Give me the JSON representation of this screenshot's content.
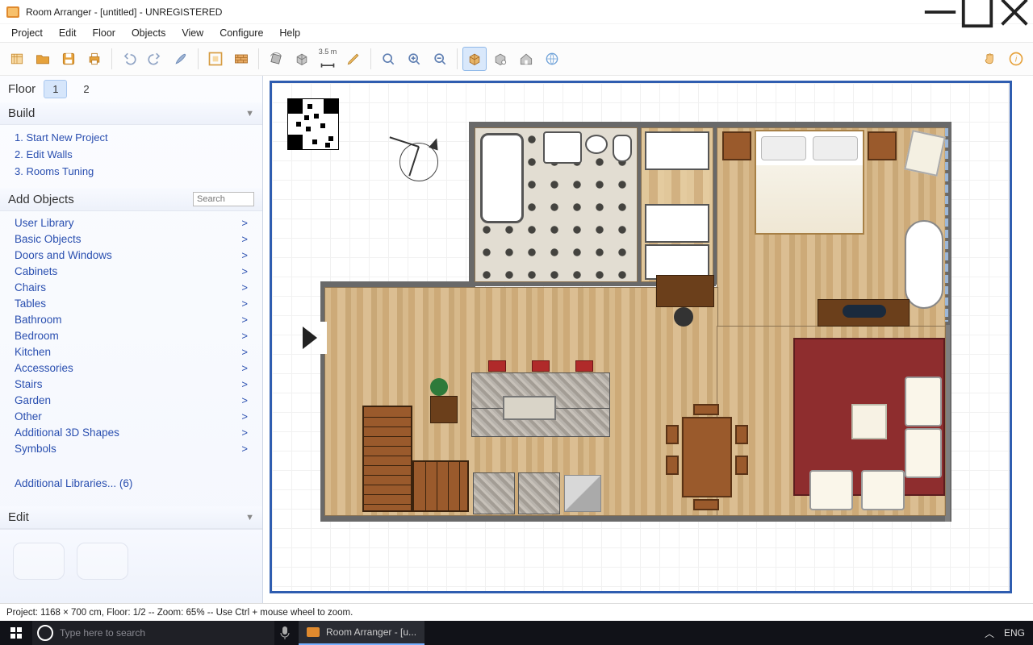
{
  "title": "Room Arranger - [untitled] - UNREGISTERED",
  "menu": [
    "Project",
    "Edit",
    "Floor",
    "Objects",
    "View",
    "Configure",
    "Help"
  ],
  "toolbar": {
    "new": "New",
    "open": "Open",
    "save": "Save",
    "print": "Print",
    "undo": "Undo",
    "redo": "Redo",
    "brush": "Brush",
    "editwalls": "Edit Walls",
    "addwall": "Add Wall",
    "rotate": "Rotate",
    "box3d": "3D Box",
    "measure_label": "3.5 m",
    "measure": "Measure",
    "pencil": "Pencil",
    "zoomfit": "Fit",
    "zoomin": "Zoom In",
    "zoomout": "Zoom Out",
    "view3d": "3D View",
    "walk": "Walkthrough",
    "house": "House",
    "globe": "Export",
    "hand": "Pan",
    "info": "Info"
  },
  "sidebar": {
    "floor_label": "Floor",
    "floors": [
      "1",
      "2"
    ],
    "active_floor": 0,
    "build_title": "Build",
    "build": [
      "1. Start New Project",
      "2. Edit Walls",
      "3. Rooms Tuning"
    ],
    "addobj_title": "Add Objects",
    "search_placeholder": "Search",
    "categories": [
      "User Library",
      "Basic Objects",
      "Doors and Windows",
      "Cabinets",
      "Chairs",
      "Tables",
      "Bathroom",
      "Bedroom",
      "Kitchen",
      "Accessories",
      "Stairs",
      "Garden",
      "Other",
      "Additional 3D Shapes",
      "Symbols"
    ],
    "additional_libs": "Additional Libraries... (6)",
    "edit_title": "Edit"
  },
  "status": "Project: 1168 × 700 cm, Floor: 1/2 -- Zoom: 65% -- Use Ctrl + mouse wheel to zoom.",
  "taskbar": {
    "search_placeholder": "Type here to search",
    "task_label": "Room Arranger - [u...",
    "lang": "ENG",
    "up_chevron": "︿"
  }
}
